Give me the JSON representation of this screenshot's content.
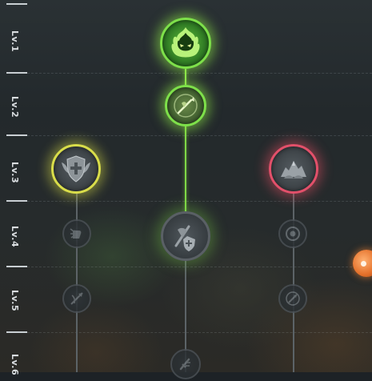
{
  "levels": [
    {
      "label": "Lv.1"
    },
    {
      "label": "Lv.2"
    },
    {
      "label": "Lv.3"
    },
    {
      "label": "Lv.4"
    },
    {
      "label": "Lv.5"
    },
    {
      "label": "Lv.6"
    }
  ],
  "colors": {
    "active_green": "#7ee04a",
    "yellow_ring": "#d9dd4a",
    "red_ring": "#e2506a",
    "locked_ring": "#4a5055",
    "side_orb": "#e4702a"
  },
  "nodes": [
    {
      "level": "Lv.1",
      "column": "center",
      "state": "active",
      "icon": "green-flame-spirit-icon"
    },
    {
      "level": "Lv.2",
      "column": "center",
      "state": "active",
      "icon": "spear-thrust-icon"
    },
    {
      "level": "Lv.3",
      "column": "left",
      "state": "unlocked",
      "icon": "winged-shield-icon"
    },
    {
      "level": "Lv.3",
      "column": "right",
      "state": "unlocked",
      "icon": "rock-spikes-icon"
    },
    {
      "level": "Lv.4",
      "column": "left",
      "state": "locked",
      "icon": "fist-strike-icon"
    },
    {
      "level": "Lv.4",
      "column": "center",
      "state": "unlocked",
      "icon": "shield-heal-icon"
    },
    {
      "level": "Lv.4",
      "column": "right",
      "state": "locked",
      "icon": "target-ring-icon"
    },
    {
      "level": "Lv.5",
      "column": "left",
      "state": "locked",
      "icon": "bow-arrow-icon"
    },
    {
      "level": "Lv.5",
      "column": "right",
      "state": "locked",
      "icon": "archer-shot-icon"
    },
    {
      "level": "Lv.6",
      "column": "center",
      "state": "locked",
      "icon": "sword-icon"
    }
  ]
}
